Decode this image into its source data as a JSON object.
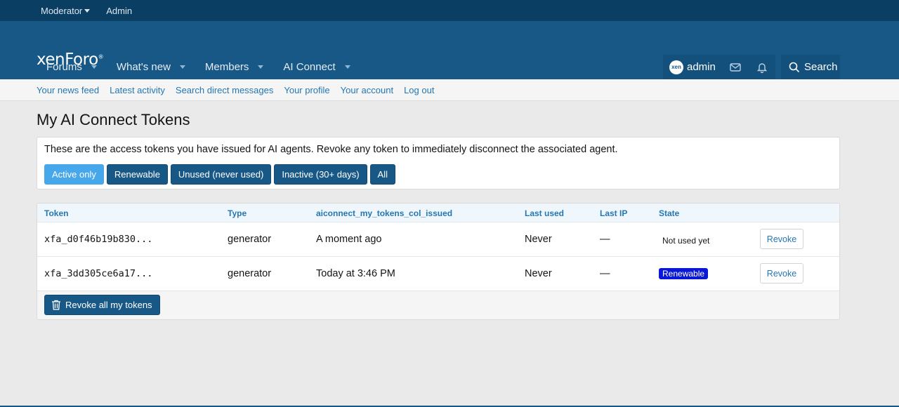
{
  "staffbar": {
    "moderator": "Moderator",
    "admin": "Admin"
  },
  "logo": {
    "text": "xenForo",
    "mark": "®"
  },
  "nav": {
    "tabs": [
      {
        "label": "Forums"
      },
      {
        "label": "What's new"
      },
      {
        "label": "Members"
      },
      {
        "label": "AI Connect"
      }
    ]
  },
  "user": {
    "name": "admin",
    "avatar_text": "xen"
  },
  "search": {
    "label": "Search"
  },
  "subnav": {
    "links": [
      "Your news feed",
      "Latest activity",
      "Search direct messages",
      "Your profile",
      "Your account",
      "Log out"
    ]
  },
  "page": {
    "title": "My AI Connect Tokens",
    "info": "These are the access tokens you have issued for AI agents. Revoke any token to immediately disconnect the associated agent."
  },
  "filters": [
    {
      "label": "Active only",
      "active": true
    },
    {
      "label": "Renewable",
      "active": false
    },
    {
      "label": "Unused (never used)",
      "active": false
    },
    {
      "label": "Inactive (30+ days)",
      "active": false
    },
    {
      "label": "All",
      "active": false
    }
  ],
  "table": {
    "headers": {
      "token": "Token",
      "type": "Type",
      "issued": "aiconnect_my_tokens_col_issued",
      "last_used": "Last used",
      "last_ip": "Last IP",
      "state": "State"
    },
    "rows": [
      {
        "token": "xfa_d0f46b19b830...",
        "type": "generator",
        "issued": "A moment ago",
        "last_used": "Never",
        "last_ip": "—",
        "state": "Not used yet",
        "action": "Revoke"
      },
      {
        "token": "xfa_3dd305ce6a17...",
        "type": "generator",
        "issued": "Today at 3:46 PM",
        "last_used": "Never",
        "last_ip": "—",
        "state": "Renewable",
        "action": "Revoke"
      }
    ],
    "footer_button": "Revoke all my tokens"
  },
  "colors": {
    "header": "#185886",
    "staffbar": "#0b3e63",
    "link": "#2577b1",
    "active_filter": "#47a7eb",
    "renewable_badge": "#0a18d6"
  },
  "icons": {
    "mail": "envelope-icon",
    "bell": "bell-icon",
    "search": "search-icon",
    "trash": "trash-icon"
  }
}
